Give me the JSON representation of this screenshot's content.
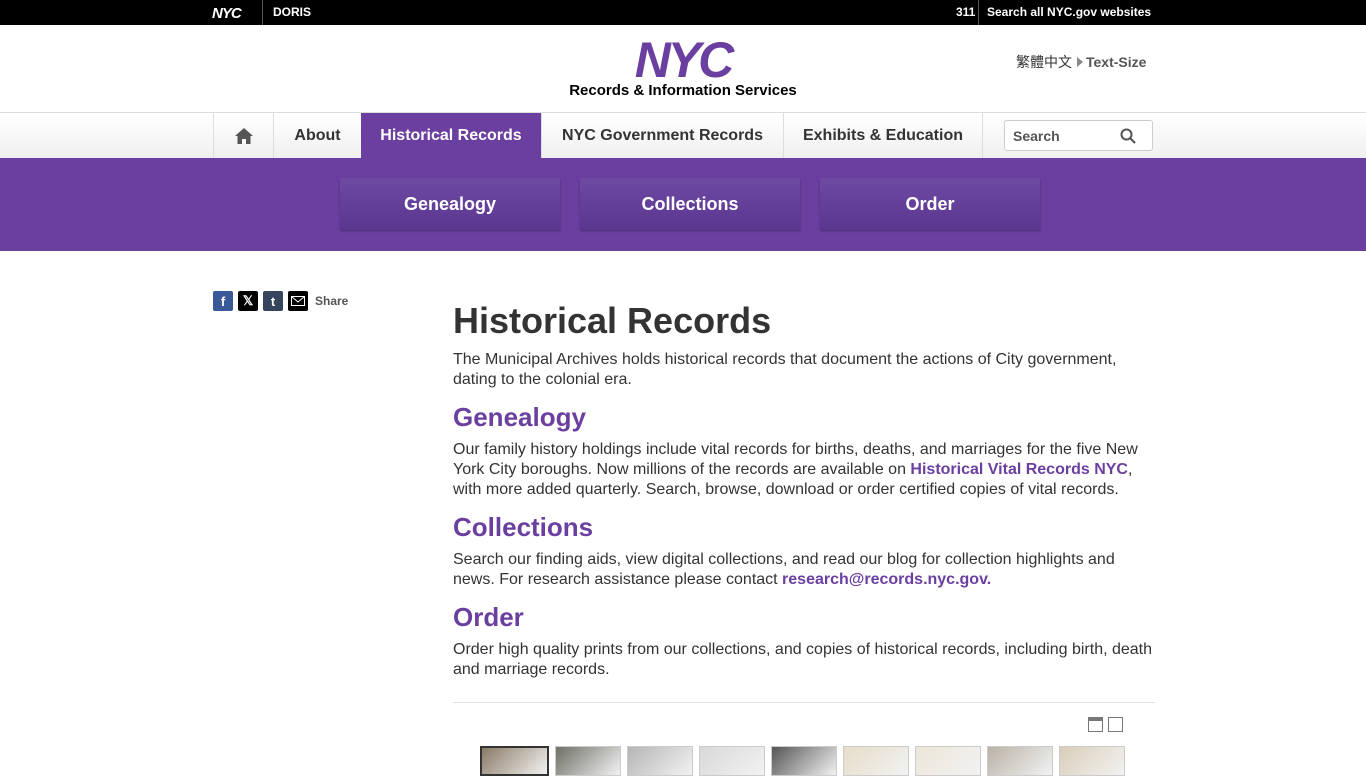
{
  "topbar": {
    "nyc_logo": "NYC",
    "doris": "DORIS",
    "n311": "311",
    "search_all": "Search all NYC.gov websites"
  },
  "header": {
    "logo_text": "Records & Information Services",
    "language": "繁體中文",
    "text_size": "Text-Size"
  },
  "nav": {
    "home_icon": "home-icon",
    "items": [
      "About",
      "Historical Records",
      "NYC Government Records",
      "Exhibits & Education"
    ],
    "search_placeholder": "Search",
    "accent": "#6b3fa0"
  },
  "subnav": {
    "buttons": [
      "Genealogy",
      "Collections",
      "Order"
    ]
  },
  "share": {
    "label": "Share",
    "icons": [
      "facebook-icon",
      "x-icon",
      "tumblr-icon",
      "email-icon"
    ]
  },
  "main": {
    "title": "Historical Records",
    "intro": "The Municipal Archives holds historical records that document the actions of City government, dating to the colonial era.",
    "genealogy": {
      "heading": "Genealogy",
      "text_before": "Our family history holdings include vital records for births, deaths, and marriages for the five New York City boroughs. Now millions of the records are available on ",
      "link": "Historical Vital Records NYC",
      "text_after": ", with more added quarterly. Search, browse, download or order certified copies of vital records."
    },
    "collections": {
      "heading": "Collections",
      "text_before": "Search our finding aids, view digital collections, and read our blog for collection highlights and news. For research assistance please contact ",
      "link": "research@records.nyc.gov",
      "text_after": "."
    },
    "order": {
      "heading": "Order",
      "text": "Order high quality prints from our collections, and copies of historical records, including birth, death and marriage records."
    }
  },
  "gallery": {
    "thumbnail_count": 9
  }
}
